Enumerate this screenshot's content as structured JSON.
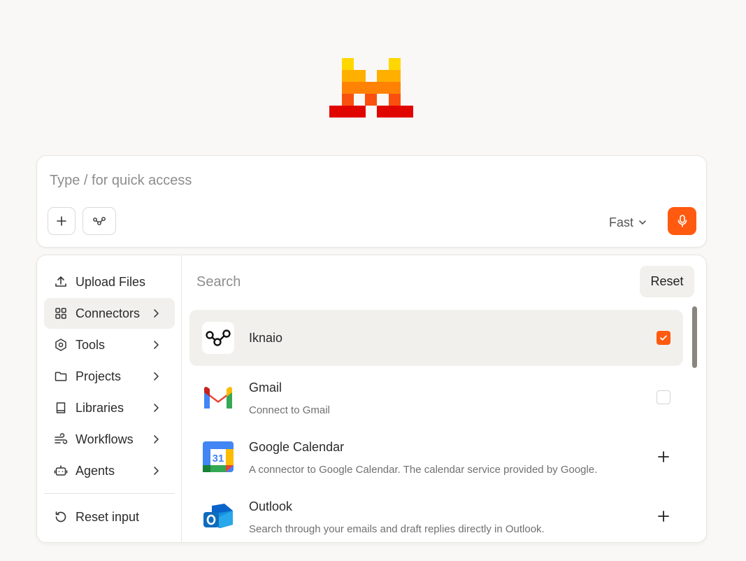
{
  "prompt": {
    "placeholder": "Type / for quick access",
    "mode_label": "Fast"
  },
  "sidebar": {
    "items": [
      {
        "label": "Upload Files",
        "icon": "upload-icon",
        "has_chevron": false
      },
      {
        "label": "Connectors",
        "icon": "grid-icon",
        "has_chevron": true,
        "active": true
      },
      {
        "label": "Tools",
        "icon": "hexagon-icon",
        "has_chevron": true
      },
      {
        "label": "Projects",
        "icon": "folder-icon",
        "has_chevron": true
      },
      {
        "label": "Libraries",
        "icon": "book-icon",
        "has_chevron": true
      },
      {
        "label": "Workflows",
        "icon": "wind-icon",
        "has_chevron": true
      },
      {
        "label": "Agents",
        "icon": "robot-icon",
        "has_chevron": true
      }
    ],
    "reset_label": "Reset input"
  },
  "connectors": {
    "search_placeholder": "Search",
    "reset_label": "Reset",
    "items": [
      {
        "title": "Iknaio",
        "description": "",
        "state": "checked"
      },
      {
        "title": "Gmail",
        "description": "Connect to Gmail",
        "state": "unchecked"
      },
      {
        "title": "Google Calendar",
        "description": "A connector to Google Calendar. The calendar service provided by Google.",
        "state": "add"
      },
      {
        "title": "Outlook",
        "description": "Search through your emails and draft replies directly in Outlook.",
        "state": "add"
      }
    ]
  },
  "colors": {
    "accent": "#ff5a0f",
    "background": "#f9f8f6",
    "selected_row": "#f1f0ed"
  }
}
